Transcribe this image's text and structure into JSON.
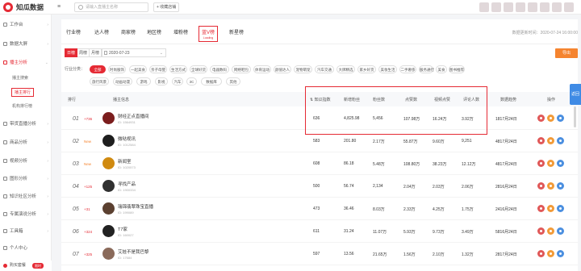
{
  "app": {
    "name": "知瓜数据",
    "collapse_glyph": "≡",
    "search_placeholder": "请输入直播主名称",
    "fav_label": "+ 收藏店铺"
  },
  "sidebar": {
    "items": [
      {
        "label": "工作台",
        "arrow": "›"
      },
      {
        "label": "数据大屏",
        "arrow": "›"
      },
      {
        "label": "播主分析",
        "arrow": "⌄",
        "active": true
      },
      {
        "label": "带货直播分析",
        "arrow": "›"
      },
      {
        "label": "商品分析",
        "arrow": "›"
      },
      {
        "label": "视频分析",
        "arrow": "›"
      },
      {
        "label": "图形分析",
        "arrow": "›"
      },
      {
        "label": "知识社区分析",
        "arrow": "›"
      },
      {
        "label": "专属演说分析",
        "arrow": "›"
      },
      {
        "label": "工具箱",
        "arrow": "›"
      },
      {
        "label": "个人中心",
        "arrow": ""
      }
    ],
    "sub_items": [
      "播主搜索",
      "播主排行",
      "机构排行榜"
    ],
    "bottom": {
      "label": "购买套餐",
      "pill": "限时"
    }
  },
  "tabs": [
    {
      "label": "行业榜"
    },
    {
      "label": "达人榜"
    },
    {
      "label": "商家榜"
    },
    {
      "label": "地区榜"
    },
    {
      "label": "增粉榜"
    },
    {
      "label": "蓝V榜",
      "active": true,
      "sub": "Loading"
    },
    {
      "label": "新星榜"
    }
  ],
  "updated_text": "数据更新时间：2020-07-24 16:00:00",
  "period_buttons": [
    "日榜",
    "周榜",
    "月榜"
  ],
  "date_value": "2020-07-23",
  "export_label": "导出",
  "category_label": "行业分类：",
  "categories_row1": [
    "全部",
    "时尚服饰",
    "一起美食",
    "亲子母婴",
    "生活方式",
    "全球好货",
    "电器数码",
    "网络鞋包",
    "体育运动",
    "颜值达人",
    "宠物萌宠",
    "汽车交通",
    "大牌精选",
    "家乡好货",
    "美妆生活",
    "二手奢侈",
    "服务通行",
    "美食",
    "图书推荐"
  ],
  "categories_row2": [
    "旅行风景",
    "动画动漫",
    "游戏",
    "影视",
    "汽车",
    "3C",
    "数据库",
    "其他"
  ],
  "table": {
    "headers": [
      "排行",
      "播主信息",
      "知瓜指数",
      "新增粉丝",
      "粉丝数",
      "点赞数",
      "视频点赞",
      "评论人数",
      "数据趋势",
      "操作"
    ],
    "rows": [
      {
        "rank": "01",
        "change": "+736",
        "change_type": "up",
        "name": "财经正点直播间",
        "id": "ID: 1564931",
        "avatar": "#7b1d1d",
        "vals": [
          "636",
          "4,825.98",
          "5,456",
          "107.98万",
          "16.24万",
          "3.92万"
        ],
        "trend": "1817月24日"
      },
      {
        "rank": "02",
        "change": "New",
        "change_type": "new",
        "name": "微哒视讯",
        "id": "ID: 1012584",
        "avatar": "#1e1e1e",
        "vals": [
          "583",
          "201.80",
          "2.17万",
          "55.87万",
          "9.60万",
          "9,251"
        ],
        "trend": "4817月24日"
      },
      {
        "rank": "03",
        "change": "New",
        "change_type": "new",
        "name": "新闻室",
        "id": "ID: 1020573",
        "avatar": "#d08a10",
        "vals": [
          "608",
          "86.18",
          "5.48万",
          "108.80万",
          "38.23万",
          "12.12万"
        ],
        "trend": "4817月24日"
      },
      {
        "rank": "04",
        "change": "+125",
        "change_type": "up",
        "name": "寻找产品",
        "id": "ID: 1900334",
        "avatar": "#303030",
        "vals": [
          "500",
          "56.74",
          "2,134",
          "2.04万",
          "2.03万",
          "2.06万"
        ],
        "trend": "2816月24日"
      },
      {
        "rank": "05",
        "change": "+31",
        "change_type": "up",
        "name": "瑞锦翡翠珠宝直播",
        "id": "ID: 199089",
        "avatar": "#5b4030",
        "vals": [
          "473",
          "36.46",
          "8.03万",
          "2.33万",
          "4.25万",
          "1.75万"
        ],
        "trend": "2416月24日"
      },
      {
        "rank": "06",
        "change": "+324",
        "change_type": "up",
        "name": "T7家",
        "id": "ID: 160027",
        "avatar": "#222222",
        "vals": [
          "611",
          "31.24",
          "11.07万",
          "5.93万",
          "9.73万",
          "3.49万"
        ],
        "trend": "5816月24日"
      },
      {
        "rank": "07",
        "change": "+325",
        "change_type": "up",
        "name": "艾娃不是我巴黎",
        "id": "ID: 17684",
        "avatar": "#8a6a5a",
        "vals": [
          "597",
          "13.56",
          "21.65万",
          "1.56万",
          "2.10万",
          "1.32万"
        ],
        "trend": "2817月24日"
      }
    ]
  },
  "right_tab": "返回"
}
